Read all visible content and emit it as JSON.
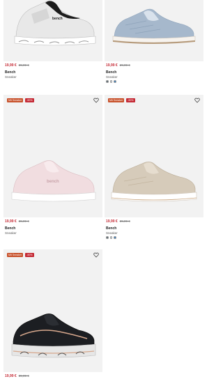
{
  "products": [
    {
      "price": "19,99 €",
      "old_price": "39,99 €",
      "brand": "Bench",
      "category": "Sneaker",
      "badges": [],
      "colors": [],
      "shoe_icon": "white-black-sneaker-image",
      "shoe_colors": {
        "upper": "#e8e8e8",
        "accent": "#1b1b1b",
        "sole": "#ffffff"
      }
    },
    {
      "price": "19,99 €",
      "old_price": "29,99 €",
      "brand": "Bench",
      "category": "Sneaker",
      "badges": [],
      "colors": [
        "#5c6b75",
        "#d7dde2",
        "#3c7fc0"
      ],
      "shoe_icon": "light-blue-sneaker-image",
      "shoe_colors": {
        "upper": "#a6b8cc",
        "accent": "#8ea3ba",
        "sole": "#f7f3ee"
      }
    },
    {
      "price": "19,99 €",
      "old_price": "39,99 €",
      "brand": "Bench",
      "category": "Sneaker",
      "badges": [
        "Mit Sneaker",
        "-50%"
      ],
      "colors": [],
      "shoe_icon": "pink-sneaker-image",
      "shoe_colors": {
        "upper": "#f1dde0",
        "accent": "#e3c3c8",
        "sole": "#ffffff"
      }
    },
    {
      "price": "19,99 €",
      "old_price": "39,99 €",
      "brand": "Bench",
      "category": "Sneaker",
      "badges": [
        "Mit Sneaker",
        "-50%"
      ],
      "colors": [
        "#5c6b75",
        "#d7dde2",
        "#3c7fc0"
      ],
      "shoe_icon": "beige-sneaker-image",
      "shoe_colors": {
        "upper": "#d6cbba",
        "accent": "#c3b59f",
        "sole": "#ffffff"
      }
    },
    {
      "price": "19,99 €",
      "old_price": "39,99 €",
      "brand": "",
      "category": "",
      "badges": [
        "Mit Sneaker",
        "-50%"
      ],
      "colors": [],
      "shoe_icon": "black-rose-sneaker-image",
      "shoe_colors": {
        "upper": "#1c1e22",
        "accent": "#d7a88d",
        "sole": "#e6e6e6"
      }
    }
  ],
  "accent_price_color": "#c52a35"
}
